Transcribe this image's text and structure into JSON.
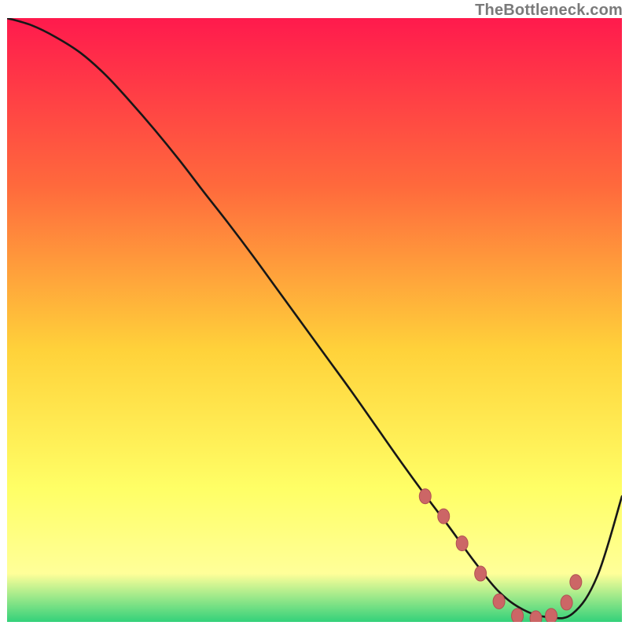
{
  "attribution": "TheBottleneck.com",
  "colors": {
    "gradient_top": "#ff1a4d",
    "gradient_mid1": "#ff6a3c",
    "gradient_mid2": "#ffd23a",
    "gradient_mid3": "#ffff66",
    "gradient_bottom_yellow": "#ffff99",
    "gradient_bottom_green": "#33d17a",
    "curve": "#171717",
    "marker_fill": "#cc6666",
    "marker_stroke": "#b05252"
  },
  "chart_data": {
    "type": "line",
    "title": "",
    "xlabel": "",
    "ylabel": "",
    "xlim": [
      0,
      100
    ],
    "ylim": [
      0,
      100
    ],
    "x": [
      0,
      4,
      8,
      12,
      16,
      20,
      24,
      28,
      32,
      36,
      40,
      44,
      48,
      52,
      56,
      60,
      64,
      68,
      72,
      76,
      80,
      84,
      88,
      92,
      96,
      100
    ],
    "values": [
      100,
      98.8,
      96.8,
      94.2,
      90.6,
      86.2,
      81.5,
      76.5,
      71.2,
      66.0,
      60.6,
      55.0,
      49.4,
      43.8,
      38.2,
      32.4,
      26.6,
      21.0,
      15.6,
      10.0,
      5.0,
      2.0,
      0.8,
      1.4,
      7.6,
      20.8
    ],
    "markers": [
      {
        "x": 68,
        "y": 20.8
      },
      {
        "x": 71,
        "y": 17.5
      },
      {
        "x": 74,
        "y": 13.0
      },
      {
        "x": 77,
        "y": 8.0
      },
      {
        "x": 80,
        "y": 3.4
      },
      {
        "x": 83,
        "y": 1.0
      },
      {
        "x": 86,
        "y": 0.6
      },
      {
        "x": 88.5,
        "y": 1.0
      },
      {
        "x": 91,
        "y": 3.2
      },
      {
        "x": 92.5,
        "y": 6.6
      }
    ]
  }
}
